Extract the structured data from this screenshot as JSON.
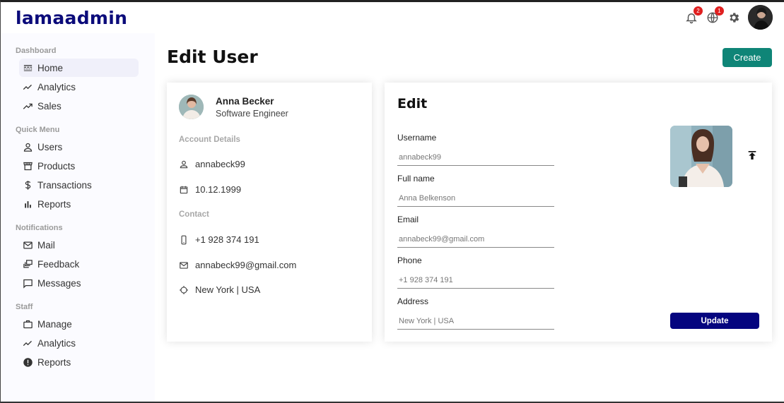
{
  "app": {
    "logo": "lamaadmin"
  },
  "topbar": {
    "notifications_badge": "2",
    "language_badge": "1"
  },
  "sidebar": {
    "sections": [
      {
        "title": "Dashboard",
        "items": [
          {
            "label": "Home",
            "icon": "line-style-icon",
            "active": true
          },
          {
            "label": "Analytics",
            "icon": "timeline-icon"
          },
          {
            "label": "Sales",
            "icon": "trending-up-icon"
          }
        ]
      },
      {
        "title": "Quick Menu",
        "items": [
          {
            "label": "Users",
            "icon": "user-icon"
          },
          {
            "label": "Products",
            "icon": "storefront-icon"
          },
          {
            "label": "Transactions",
            "icon": "dollar-icon"
          },
          {
            "label": "Reports",
            "icon": "bar-chart-icon"
          }
        ]
      },
      {
        "title": "Notifications",
        "items": [
          {
            "label": "Mail",
            "icon": "mail-icon"
          },
          {
            "label": "Feedback",
            "icon": "dynamic-feed-icon"
          },
          {
            "label": "Messages",
            "icon": "chat-bubble-icon"
          }
        ]
      },
      {
        "title": "Staff",
        "items": [
          {
            "label": "Manage",
            "icon": "work-icon"
          },
          {
            "label": "Analytics",
            "icon": "timeline-icon"
          },
          {
            "label": "Reports",
            "icon": "report-icon"
          }
        ]
      }
    ]
  },
  "main": {
    "title": "Edit User",
    "create_label": "Create"
  },
  "user_show": {
    "name": "Anna Becker",
    "job": "Software Engineer",
    "account_title": "Account Details",
    "username": "annabeck99",
    "birthday": "10.12.1999",
    "contact_title": "Contact",
    "phone": "+1 928 374 191",
    "email": "annabeck99@gmail.com",
    "address": "New York | USA"
  },
  "user_edit": {
    "title": "Edit",
    "fields": [
      {
        "label": "Username",
        "placeholder": "annabeck99"
      },
      {
        "label": "Full name",
        "placeholder": "Anna Belkenson"
      },
      {
        "label": "Email",
        "placeholder": "annabeck99@gmail.com"
      },
      {
        "label": "Phone",
        "placeholder": "+1 928 374 191"
      },
      {
        "label": "Address",
        "placeholder": "New York | USA"
      }
    ],
    "update_label": "Update"
  },
  "colors": {
    "logo": "#0b0b7a",
    "create_button": "#0f8577",
    "update_button": "#05057f",
    "badge": "#e02020"
  }
}
